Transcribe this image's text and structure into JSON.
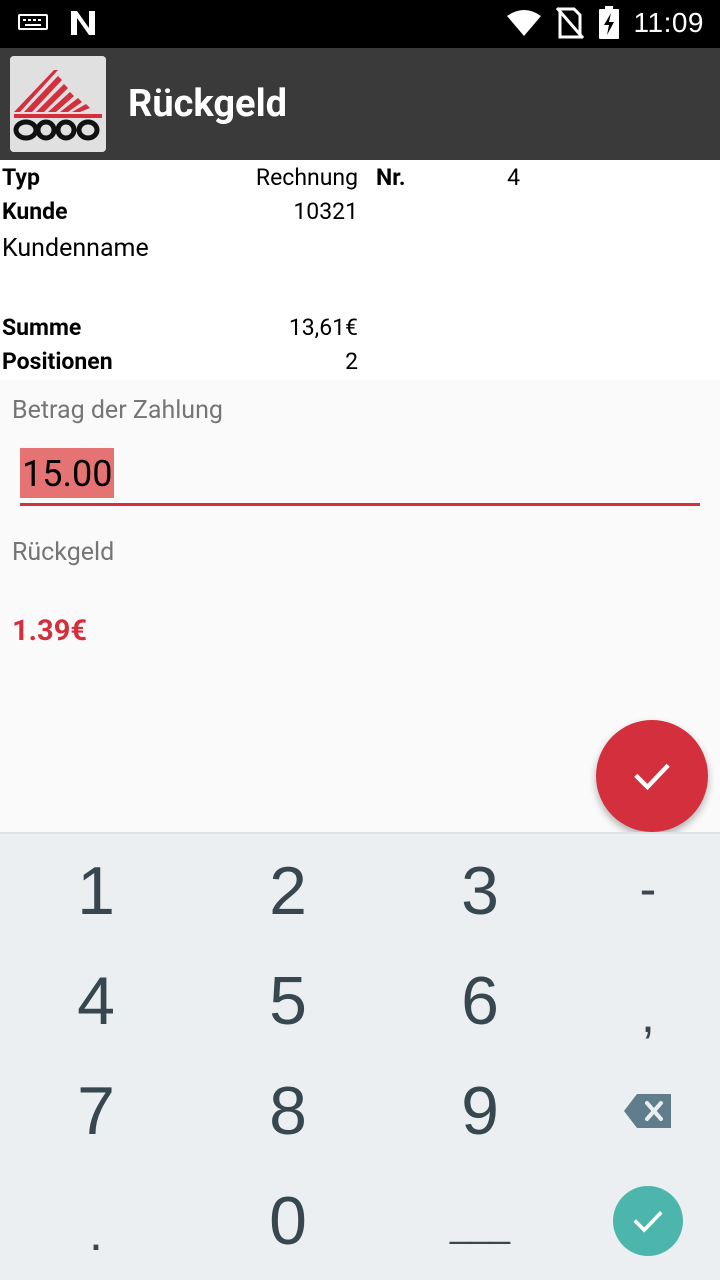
{
  "status_bar": {
    "time": "11:09"
  },
  "app_bar": {
    "title": "Rückgeld"
  },
  "info": {
    "typ_label": "Typ",
    "typ_value": "Rechnung",
    "nr_label": "Nr.",
    "nr_value": "4",
    "kunde_label": "Kunde",
    "kunde_value": "10321",
    "kundenname": "Kundenname",
    "summe_label": "Summe",
    "summe_value": "13,61€",
    "positionen_label": "Positionen",
    "positionen_value": "2"
  },
  "payment": {
    "label": "Betrag der Zahlung",
    "value": "15.00",
    "change_label": "Rückgeld",
    "change_value": "1.39€"
  },
  "colors": {
    "accent": "#d32f3c",
    "appbar": "#3a3a3a",
    "keyboard_enter": "#4db6ac"
  },
  "keyboard": {
    "k1": "1",
    "k2": "2",
    "k3": "3",
    "k_minus": "-",
    "k4": "4",
    "k5": "5",
    "k6": "6",
    "k_comma": ",",
    "k7": "7",
    "k8": "8",
    "k9": "9",
    "k_dot": ".",
    "k0": "0",
    "k_space": "___"
  },
  "icons": {
    "fab": "check-icon",
    "backspace": "backspace-icon",
    "enter": "check-icon"
  }
}
